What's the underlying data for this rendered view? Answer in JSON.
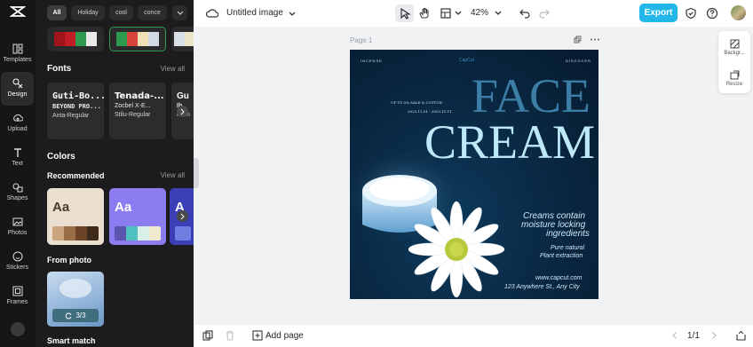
{
  "app": {
    "document_title": "Untitled image"
  },
  "rail": {
    "items": [
      {
        "label": "Templates",
        "icon": "templates-icon"
      },
      {
        "label": "Design",
        "icon": "design-icon"
      },
      {
        "label": "Upload",
        "icon": "upload-icon"
      },
      {
        "label": "Text",
        "icon": "text-icon"
      },
      {
        "label": "Shapes",
        "icon": "shapes-icon"
      },
      {
        "label": "Photos",
        "icon": "photos-icon"
      },
      {
        "label": "Stickers",
        "icon": "stickers-icon"
      },
      {
        "label": "Frames",
        "icon": "frames-icon"
      }
    ]
  },
  "panel": {
    "chips": [
      "All",
      "Holiday",
      "cool",
      "conce"
    ],
    "fonts": {
      "title": "Fonts",
      "view_all": "View all",
      "cards": [
        {
          "line1": "Guti-Bo...",
          "line2": "BEYOND PRO...",
          "line3": "Anta-Regular"
        },
        {
          "line1": "Tenada-...",
          "line2": "Zocbel X-E...",
          "line3": "Stilu-Regular"
        },
        {
          "line1": "Gu",
          "line2": "Ib",
          "line3": "Ham"
        }
      ]
    },
    "colors": {
      "title": "Colors",
      "recommended": "Recommended",
      "view_all": "View all",
      "cards": [
        {
          "aa": "Aa",
          "bg": "#eaded0",
          "fg": "#4a3a2c",
          "swatches": [
            "#c9a47c",
            "#9a6e45",
            "#6b4428",
            "#3f2a1a"
          ]
        },
        {
          "aa": "Aa",
          "bg": "#8b7cf0",
          "fg": "#ffffff",
          "swatches": [
            "#5b55b0",
            "#4fc1c1",
            "#d8f0e8",
            "#f2ead0"
          ]
        },
        {
          "aa": "A",
          "bg": "#3b3fb6",
          "fg": "#ffffff",
          "swatches": [
            "#6d7de0"
          ]
        }
      ]
    },
    "from_photo": {
      "title": "From photo",
      "badge": "3/3"
    },
    "smart_match": {
      "title": "Smart match"
    },
    "palette_strips": [
      [
        "#a0151c",
        "#c21d24",
        "#2e9a4f",
        "#eaeaea"
      ],
      [
        "#2e9a4f",
        "#d8453d",
        "#efe0b8",
        "#cfd8e4"
      ],
      [
        "#d8dfe9",
        "#eae5c8"
      ]
    ]
  },
  "toolbar": {
    "zoom": "42%",
    "export": "Export"
  },
  "canvas": {
    "page_label": "Page 1",
    "design": {
      "nav_left": "INCENSE",
      "brand": "CapCut",
      "nav_right": "DISCOVER",
      "promo_line1": "UP TO 5% SALE & COTTON",
      "promo_line2": "2023.11.01 - 2023.11.11",
      "face": "FACE",
      "cream": "CREAM",
      "tagline1": "Creams contain",
      "tagline2": "moisture locking",
      "tagline3": "ingredients",
      "natural1": "Pure natural",
      "natural2": "Plant extraction",
      "website": "www.capcut.com",
      "address": "123 Anywhere St., Any City"
    }
  },
  "float_panel": {
    "background": "Backgr...",
    "resize": "Resize"
  },
  "bottombar": {
    "add_page": "Add page",
    "pagination": "1/1"
  }
}
